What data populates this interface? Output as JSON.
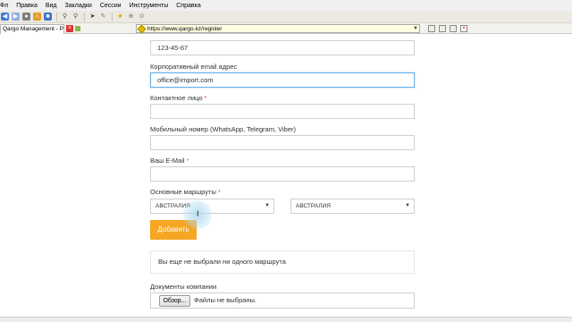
{
  "menu": {
    "items": [
      "Фл",
      "Правка",
      "Вид",
      "Закладки",
      "Сессии",
      "Инструменты",
      "Справка"
    ]
  },
  "toolbar": {
    "icons": [
      "back-icon",
      "forward-icon",
      "reload-icon",
      "home-icon",
      "save-icon",
      "zoom-in-icon",
      "zoom-out-icon",
      "cursor-icon",
      "edit-icon",
      "bookmark-star-icon",
      "bookmark-add-icon",
      "bookmark-menu-icon"
    ]
  },
  "tab": {
    "title": "Qargo Management - PE...",
    "close": "×"
  },
  "url": {
    "value": "https://www.qargo.kz/register",
    "close": "×"
  },
  "form": {
    "office_phone": {
      "value": "123-45-67"
    },
    "corporate_email": {
      "label": "Корпоративный email адрес",
      "value": "office@import.com"
    },
    "contact_person": {
      "label": "Контактное лицо",
      "required": "*",
      "value": ""
    },
    "mobile": {
      "label": "Мобильный номер (WhatsApp, Telegram, Viber)",
      "value": ""
    },
    "your_email": {
      "label": "Ваш E-Mail",
      "required": "*",
      "value": ""
    },
    "routes": {
      "label": "Основные маршруты",
      "required": "*",
      "from": "АВСТРАЛИЯ",
      "to": "АВСТРАЛИЯ",
      "add_button": "Добавить",
      "empty_message": "Вы еще не выбрали ни одного маршрута"
    },
    "documents": {
      "label": "Документы компании",
      "browse_button": "Обзор...",
      "no_file_text": "Файлы не выбраны."
    }
  },
  "colors": {
    "accent_button": "#f5a623",
    "focus_border": "#66afe9",
    "required_mark": "#d9534f",
    "url_background": "#ffffe0"
  }
}
